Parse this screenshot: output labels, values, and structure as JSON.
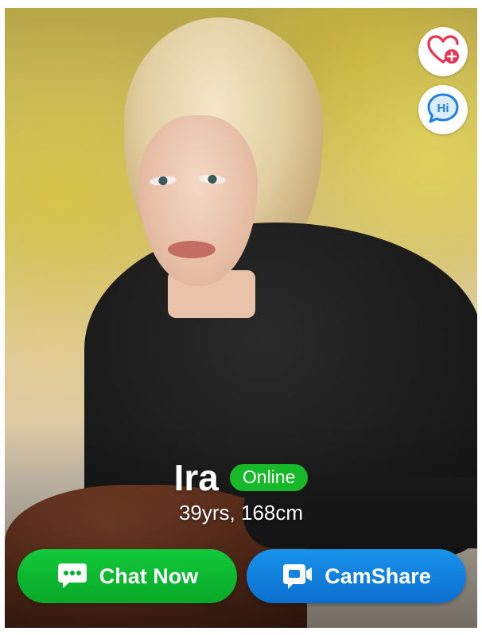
{
  "profile": {
    "name": "Ira",
    "status": "Online",
    "details": "39yrs, 168cm"
  },
  "actions": {
    "like_icon": "heart-plus-icon",
    "hi_icon": "hi-speech-bubble-icon",
    "hi_text": "Hi"
  },
  "buttons": {
    "chat_label": "Chat Now",
    "chat_icon": "chat-bubble-icon",
    "camshare_label": "CamShare",
    "camshare_icon": "video-camera-icon"
  },
  "colors": {
    "online_green": "#17b82a",
    "chat_green": "#12c93a",
    "camshare_blue": "#1793ea",
    "heart_red": "#e8344e",
    "hi_blue": "#1d7fe0"
  }
}
